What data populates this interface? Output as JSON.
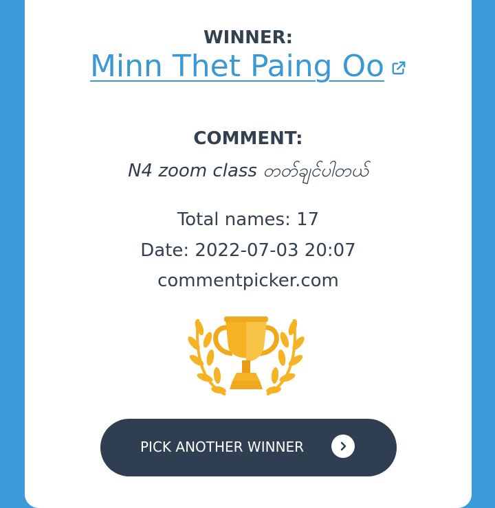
{
  "winner": {
    "label": "WINNER:",
    "name": "Minn Thet Paing Oo",
    "link_icon": "external-link-icon"
  },
  "comment": {
    "label": "COMMENT:",
    "text": "N4 zoom class တတ်ချင်ပါတယ်"
  },
  "stats": {
    "total_names": "Total names: 17",
    "date": "Date: 2022-07-03 20:07",
    "site": "commentpicker.com"
  },
  "trophy_icon": "trophy-icon",
  "button": {
    "label": "PICK ANOTHER WINNER",
    "icon": "chevron-right-icon"
  },
  "colors": {
    "background": "#3d9ad8",
    "link": "#3a98d4",
    "text": "#33404f",
    "button": "#2f3f51",
    "trophy": "#f5b324"
  }
}
